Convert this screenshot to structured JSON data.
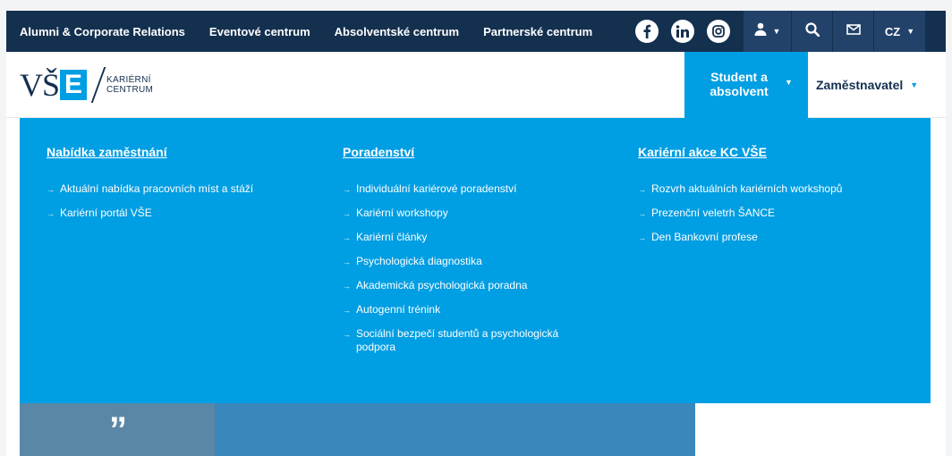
{
  "topbar": {
    "links": [
      "Alumni & Corporate Relations",
      "Eventové centrum",
      "Absolventské centrum",
      "Partnerské centrum"
    ],
    "social_icons": [
      "facebook-icon",
      "linkedin-icon",
      "instagram-icon"
    ],
    "language": "CZ"
  },
  "header": {
    "logo": {
      "mark_a": "VŠ",
      "mark_b": "E",
      "line1": "KARIÉRNÍ",
      "line2": "CENTRUM"
    },
    "nav": {
      "student_line1": "Student a",
      "student_line2": "absolvent",
      "employer": "Zaměstnavatel"
    }
  },
  "menu": {
    "columns": [
      {
        "title": "Nabídka zaměstnání",
        "items": [
          "Aktuální nabídka pracovních míst a stáží",
          "Kariérní portál VŠE"
        ]
      },
      {
        "title": "Poradenství",
        "items": [
          "Individuální kariérové poradenství",
          "Kariérní workshopy",
          "Kariérní články",
          "Psychologická diagnostika",
          "Akademická psychologická poradna",
          "Autogenní trénink",
          "Sociální bezpečí studentů a psychologická podpora"
        ]
      },
      {
        "title": "Kariérní akce KC VŠE",
        "items": [
          "Rozvrh aktuálních kariérních workshopů",
          "Prezenční veletrh ŠANCE",
          "Den Bankovní profese"
        ]
      }
    ]
  },
  "colors": {
    "topbar": "#14304f",
    "accent": "#009ee3",
    "white": "#ffffff"
  }
}
